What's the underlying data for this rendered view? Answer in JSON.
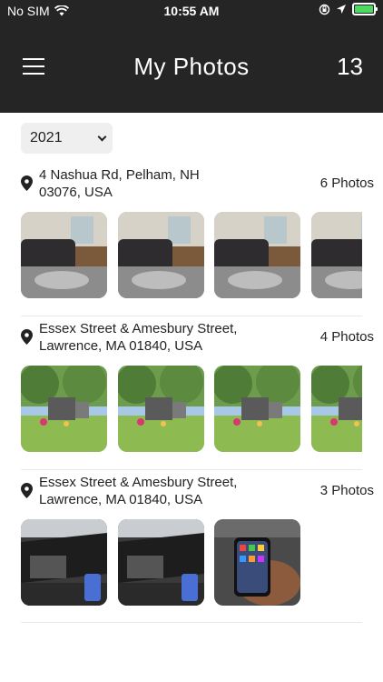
{
  "status_bar": {
    "carrier": "No SIM",
    "time": "10:55 AM",
    "battery_color": "#4cd964"
  },
  "nav": {
    "title": "My Photos",
    "count": "13",
    "menu_icon": "hamburger-menu-icon"
  },
  "filter": {
    "year": "2021"
  },
  "sections": [
    {
      "address_line1": "4 Nashua Rd, Pelham, NH",
      "address_line2": "03076, USA",
      "count_label": "6 Photos",
      "thumbs": [
        "living-room",
        "living-room",
        "living-room",
        "living-room"
      ]
    },
    {
      "address_line1": "Essex Street & Amesbury Street,",
      "address_line2": "Lawrence, MA 01840, USA",
      "count_label": "4 Photos",
      "thumbs": [
        "cemetery",
        "cemetery",
        "cemetery",
        "cemetery"
      ]
    },
    {
      "address_line1": "Essex Street & Amesbury Street,",
      "address_line2": "Lawrence, MA 01840, USA",
      "count_label": "3 Photos",
      "thumbs": [
        "car-interior",
        "car-interior",
        "phone-in-car"
      ]
    }
  ],
  "colors": {
    "nav_background": "#252525",
    "accent": "#ffffff"
  }
}
